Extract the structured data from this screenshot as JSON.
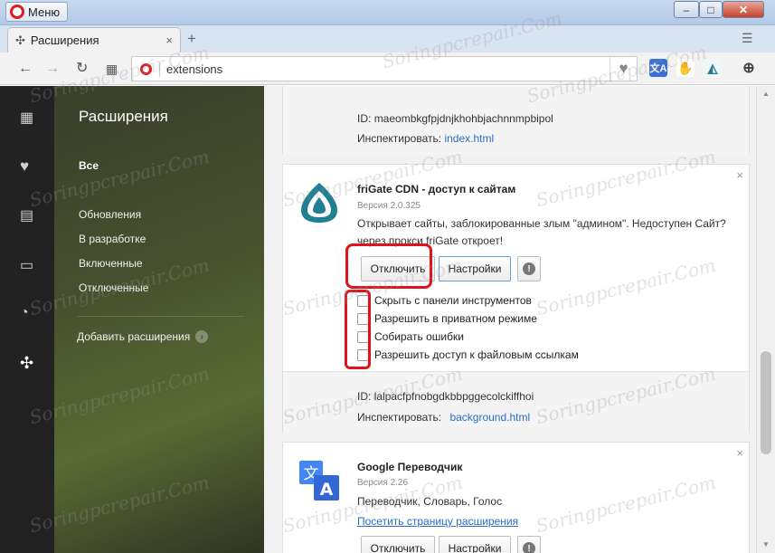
{
  "window": {
    "menu_label": "Меню",
    "tab_title": "Расширения",
    "controls": [
      "–",
      "□",
      "✕"
    ]
  },
  "toolbar": {
    "address": "extensions"
  },
  "sidebar": {
    "heading": "Расширения",
    "items": [
      {
        "label": "Все",
        "active": true
      },
      {
        "label": "Обновления",
        "active": false
      },
      {
        "label": "В разработке",
        "active": false
      },
      {
        "label": "Включенные",
        "active": false
      },
      {
        "label": "Отключенные",
        "active": false
      }
    ],
    "add_label": "Добавить расширения"
  },
  "extensions": [
    {
      "id_label": "ID:",
      "id_value": "maeombkgfpjdnjkhohbjachnnmpbipol",
      "inspect_label": "Инспектировать:",
      "inspect_link": "index.html"
    },
    {
      "name": "friGate CDN - доступ к сайтам",
      "version": "Версия 2.0.325",
      "description": "Открывает сайты, заблокированные злым \"админом\". Недоступен Сайт? через прокси friGate откроет!",
      "disable_label": "Отключить",
      "settings_label": "Настройки",
      "options": [
        "Скрыть с панели инструментов",
        "Разрешить в приватном режиме",
        "Собирать ошибки",
        "Разрешить доступ к файловым ссылкам"
      ],
      "id_label": "ID:",
      "id_value": "lalpacfpfnobgdkbbpggecolckiffhoi",
      "inspect_label": "Инспектировать:",
      "inspect_link": "background.html"
    },
    {
      "name": "Google Переводчик",
      "version": "Версия 2.26",
      "description": "Переводчик, Словарь, Голос",
      "page_link": "Посетить страницу расширения",
      "disable_label": "Отключить",
      "settings_label": "Настройки"
    }
  ],
  "watermark": "Soringpcrepair.Com",
  "colors": {
    "accent": "#e01b22",
    "link": "#2a6cc8",
    "highlight": "#e0121b"
  }
}
